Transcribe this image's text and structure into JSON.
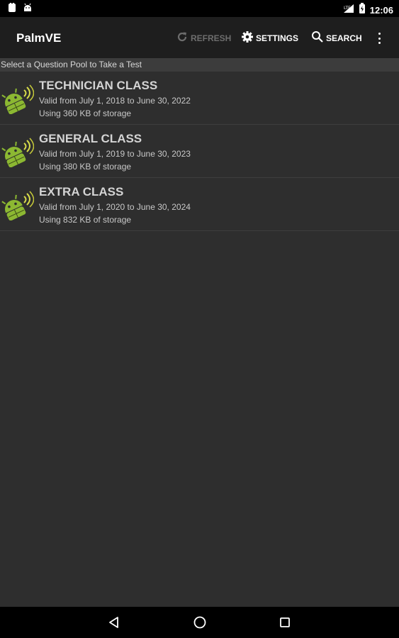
{
  "status_bar": {
    "time": "12:06",
    "left_icons": [
      "notification-icon",
      "android-icon"
    ],
    "right_icons": [
      "signal-icon",
      "battery-icon"
    ]
  },
  "app_bar": {
    "title": "PalmVE",
    "actions": [
      {
        "label": "REFRESH",
        "icon": "refresh-icon",
        "enabled": false
      },
      {
        "label": "SETTINGS",
        "icon": "gear-icon",
        "enabled": true
      },
      {
        "label": "SEARCH",
        "icon": "search-icon",
        "enabled": true
      }
    ],
    "overflow_icon": "more-vert-icon"
  },
  "section_header": "Select a Question Pool to Take a Test",
  "pools": [
    {
      "title": "TECHNICIAN CLASS",
      "valid": "Valid from July 1, 2018 to June 30, 2022",
      "storage": "Using 360 KB of storage",
      "icon": "android-radio-icon"
    },
    {
      "title": "GENERAL CLASS",
      "valid": "Valid from July 1, 2019 to June 30, 2023",
      "storage": "Using 380 KB of storage",
      "icon": "android-radio-icon"
    },
    {
      "title": "EXTRA CLASS",
      "valid": "Valid from July 1, 2020 to June 30, 2024",
      "storage": "Using 832 KB of storage",
      "icon": "android-radio-icon"
    }
  ],
  "nav_bar": {
    "icons": [
      "back-icon",
      "home-icon",
      "recents-icon"
    ]
  },
  "colors": {
    "app_bar": "#1e1e1e",
    "content_bg": "#2e2e2e",
    "section_header_bg": "#3c3c3c",
    "icon_green": "#8cb832",
    "signal_yellow": "#d8dc4a"
  }
}
